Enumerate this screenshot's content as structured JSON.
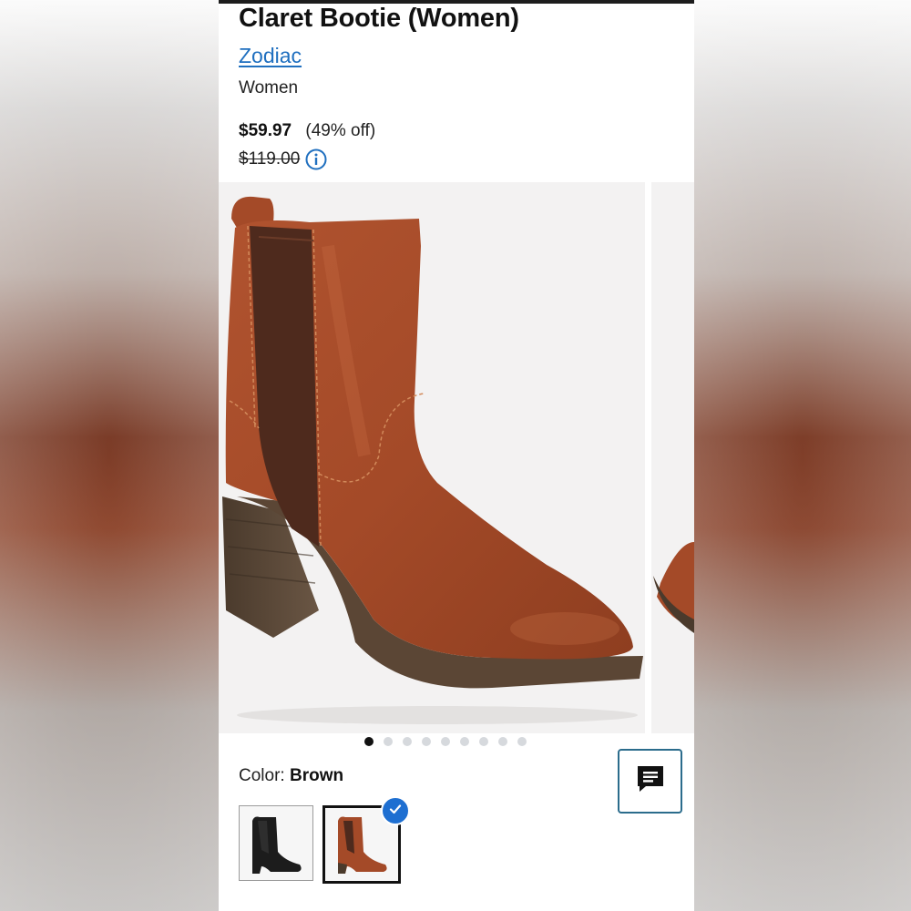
{
  "product": {
    "title": "Claret Bootie (Women)",
    "brand": "Zodiac",
    "department": "Women",
    "price": "$59.97",
    "discount": "(49% off)",
    "original_price": "$119.00"
  },
  "carousel": {
    "total_images": 9,
    "active_index": 0
  },
  "color": {
    "label": "Color:",
    "selected": "Brown",
    "swatches": [
      {
        "name": "black-boot-swatch",
        "selected": false
      },
      {
        "name": "brown-boot-swatch",
        "selected": true
      }
    ]
  },
  "icons": {
    "info": "info-icon",
    "chat": "chat-icon",
    "check": "check-icon"
  },
  "colors": {
    "link": "#1f6fbf",
    "check_badge": "#1e6fd1",
    "chat_border": "#2b6c8c"
  }
}
